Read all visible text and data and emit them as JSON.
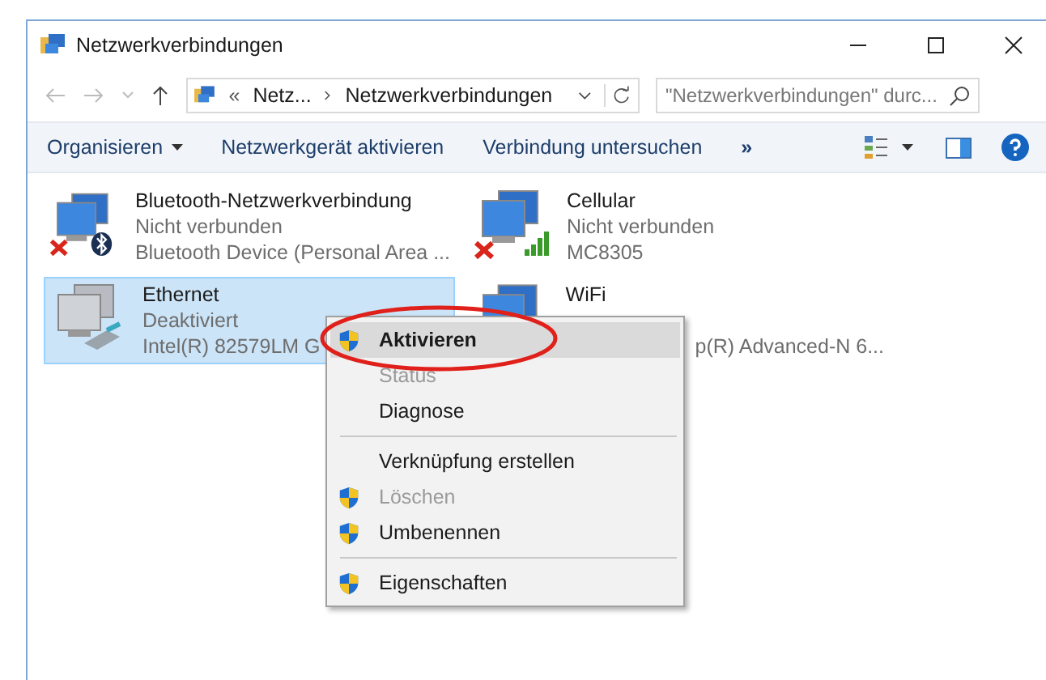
{
  "window": {
    "title": "Netzwerkverbindungen"
  },
  "address": {
    "overflow": "«",
    "crumbs": [
      "Netz...",
      "Netzwerkverbindungen"
    ]
  },
  "search": {
    "placeholder": "\"Netzwerkverbindungen\" durc..."
  },
  "toolbar": {
    "items": [
      {
        "label": "Organisieren",
        "dropdown": true
      },
      {
        "label": "Netzwerkgerät aktivieren",
        "dropdown": false
      },
      {
        "label": "Verbindung untersuchen",
        "dropdown": false
      }
    ],
    "more": "»"
  },
  "connections": [
    {
      "name": "Bluetooth-Netzwerkverbindung",
      "status": "Nicht verbunden",
      "device": "Bluetooth Device (Personal Area ...",
      "kind": "bluetooth",
      "disconnected": true,
      "selected": false,
      "covered": false
    },
    {
      "name": "Cellular",
      "status": "Nicht verbunden",
      "device": "MC8305",
      "kind": "cellular",
      "disconnected": true,
      "selected": false,
      "covered": false
    },
    {
      "name": "Ethernet",
      "status": "Deaktiviert",
      "device": "Intel(R) 82579LM G",
      "kind": "ethernet",
      "disconnected": false,
      "selected": true,
      "covered": false
    },
    {
      "name": "WiFi",
      "device": "p(R) Advanced-N 6...",
      "kind": "wifi",
      "disconnected": false,
      "selected": false,
      "covered": true
    }
  ],
  "context_menu": {
    "items": [
      {
        "kind": "item",
        "label": "Aktivieren",
        "shield": true,
        "bold": true,
        "disabled": false,
        "selected": true
      },
      {
        "kind": "item",
        "label": "Status",
        "shield": false,
        "bold": false,
        "disabled": true,
        "selected": false
      },
      {
        "kind": "item",
        "label": "Diagnose",
        "shield": false,
        "bold": false,
        "disabled": false,
        "selected": false
      },
      {
        "kind": "separator"
      },
      {
        "kind": "item",
        "label": "Verknüpfung erstellen",
        "shield": false,
        "bold": false,
        "disabled": false,
        "selected": false
      },
      {
        "kind": "item",
        "label": "Löschen",
        "shield": true,
        "bold": false,
        "disabled": true,
        "selected": false
      },
      {
        "kind": "item",
        "label": "Umbenennen",
        "shield": true,
        "bold": false,
        "disabled": false,
        "selected": false
      },
      {
        "kind": "separator"
      },
      {
        "kind": "item",
        "label": "Eigenschaften",
        "shield": true,
        "bold": false,
        "disabled": false,
        "selected": false
      }
    ]
  }
}
